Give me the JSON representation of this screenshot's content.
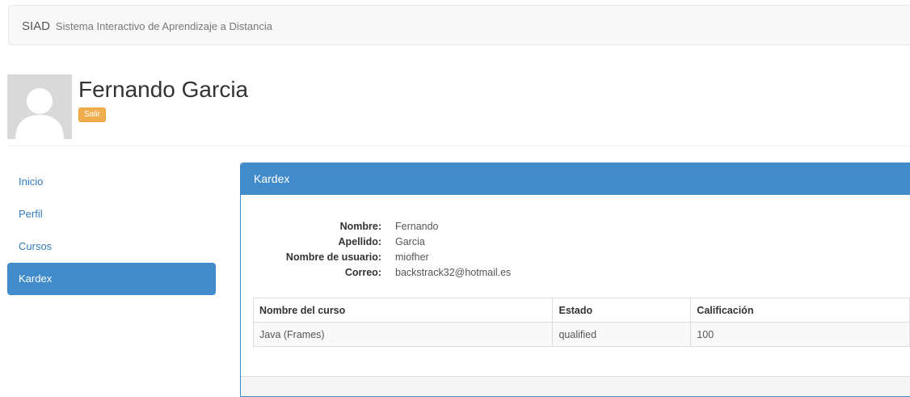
{
  "navbar": {
    "brand_short": "SIAD",
    "brand_long": "Sistema Interactivo de Aprendizaje a Distancia"
  },
  "user": {
    "name": "Fernando Garcia",
    "logout_label": "Salir"
  },
  "sidebar": {
    "items": [
      {
        "label": "Inicio",
        "active": false
      },
      {
        "label": "Perfil",
        "active": false
      },
      {
        "label": "Cursos",
        "active": false
      },
      {
        "label": "Kardex",
        "active": true
      }
    ]
  },
  "panel": {
    "title": "Kardex",
    "info": [
      {
        "label": "Nombre:",
        "value": "Fernando"
      },
      {
        "label": "Apellido:",
        "value": "Garcia"
      },
      {
        "label": "Nombre de usuario:",
        "value": "miofher"
      },
      {
        "label": "Correo:",
        "value": "backstrack32@hotmail.es"
      }
    ],
    "table": {
      "headers": [
        "Nombre del curso",
        "Estado",
        "Calificación"
      ],
      "rows": [
        [
          "Java (Frames)",
          "qualified",
          "100"
        ]
      ]
    }
  },
  "colors": {
    "primary": "#428bca",
    "warning": "#f0ad4e",
    "link": "#337ab7"
  },
  "icons": {
    "avatar": "user-silhouette-icon"
  }
}
